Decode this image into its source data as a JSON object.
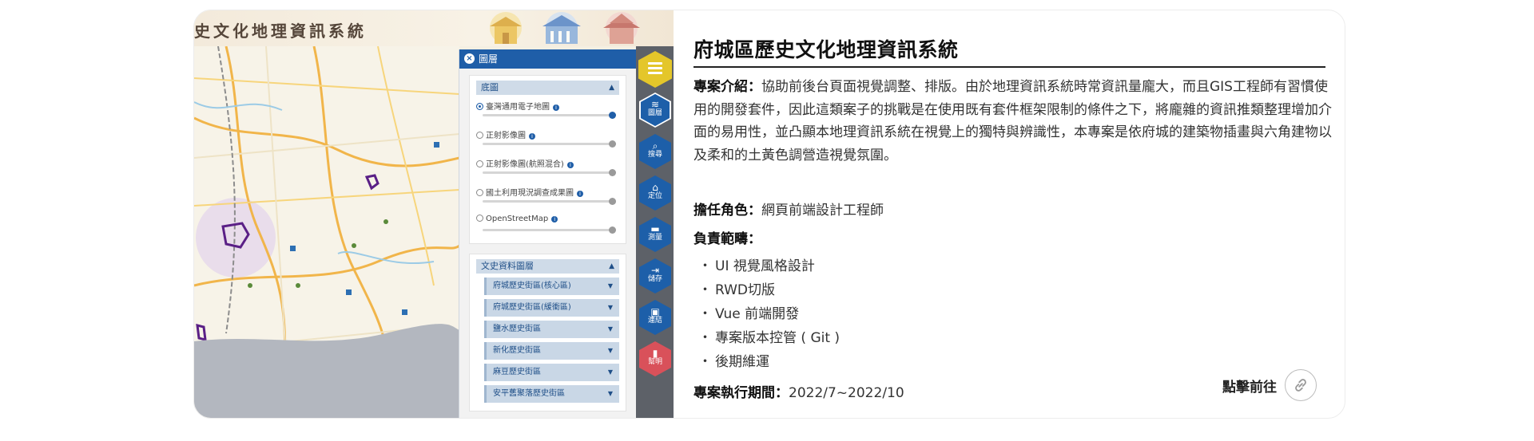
{
  "shot": {
    "app_title": "史文化地理資訊系統",
    "layer_panel_title": "圖層",
    "basemap_section": "底圖",
    "basemap_options": [
      "臺灣通用電子地圖",
      "正射影像圖",
      "正射影像圖(航照混合)",
      "國土利用現況調查成果圖",
      "OpenStreetMap"
    ],
    "basemap_selected": "臺灣通用電子地圖",
    "history_section": "文史資料圖層",
    "history_items": [
      "府城歷史街區(核心區)",
      "府城歷史街區(緩衝區)",
      "鹽水歷史街區",
      "新化歷史街區",
      "麻豆歷史街區",
      "安平舊聚落歷史街區"
    ],
    "tools": [
      {
        "icon": "menu-icon",
        "label": ""
      },
      {
        "icon": "layers-icon",
        "label": "圖層"
      },
      {
        "icon": "search-icon",
        "label": "搜尋"
      },
      {
        "icon": "locate-icon",
        "label": "定位"
      },
      {
        "icon": "measure-icon",
        "label": "測量"
      },
      {
        "icon": "save-icon",
        "label": "儲存"
      },
      {
        "icon": "link-icon",
        "label": "連結"
      },
      {
        "icon": "help-icon",
        "label": "幫明"
      }
    ],
    "colors": {
      "toolbar": "#5d6168",
      "tool_blue": "#1d5fa9",
      "menu_yellow": "#e4c62a",
      "help_red": "#d9515a",
      "panel_head": "#1f5ea8"
    }
  },
  "project": {
    "title": "府城區歷史文化地理資訊系統",
    "intro_label": "專案介紹：",
    "intro_text": "協助前後台頁面視覺調整、排版。由於地理資訊系統時常資訊量龐大，而且GIS工程師有習慣使用的開發套件，因此這類案子的挑戰是在使用既有套件框架限制的條件之下，將龐雜的資訊推類整理增加介面的易用性，並凸顯本地理資訊系統在視覺上的獨特與辨識性，本專案是依府城的建築物插畫與六角建物以及柔和的土黃色調營造視覺氛圍。",
    "role_label": "擔任角色：",
    "role_value": "網頁前端設計工程師",
    "scope_label": "負責範疇：",
    "scope_items": [
      "UI 視覺風格設計",
      "RWD切版",
      "Vue 前端開發",
      "專案版本控管 ( Git )",
      "後期維運"
    ],
    "period_label": "專案執行期間：",
    "period_value": "2022/7~2022/10",
    "go_label": "點擊前往",
    "go_icon": "link-icon"
  }
}
